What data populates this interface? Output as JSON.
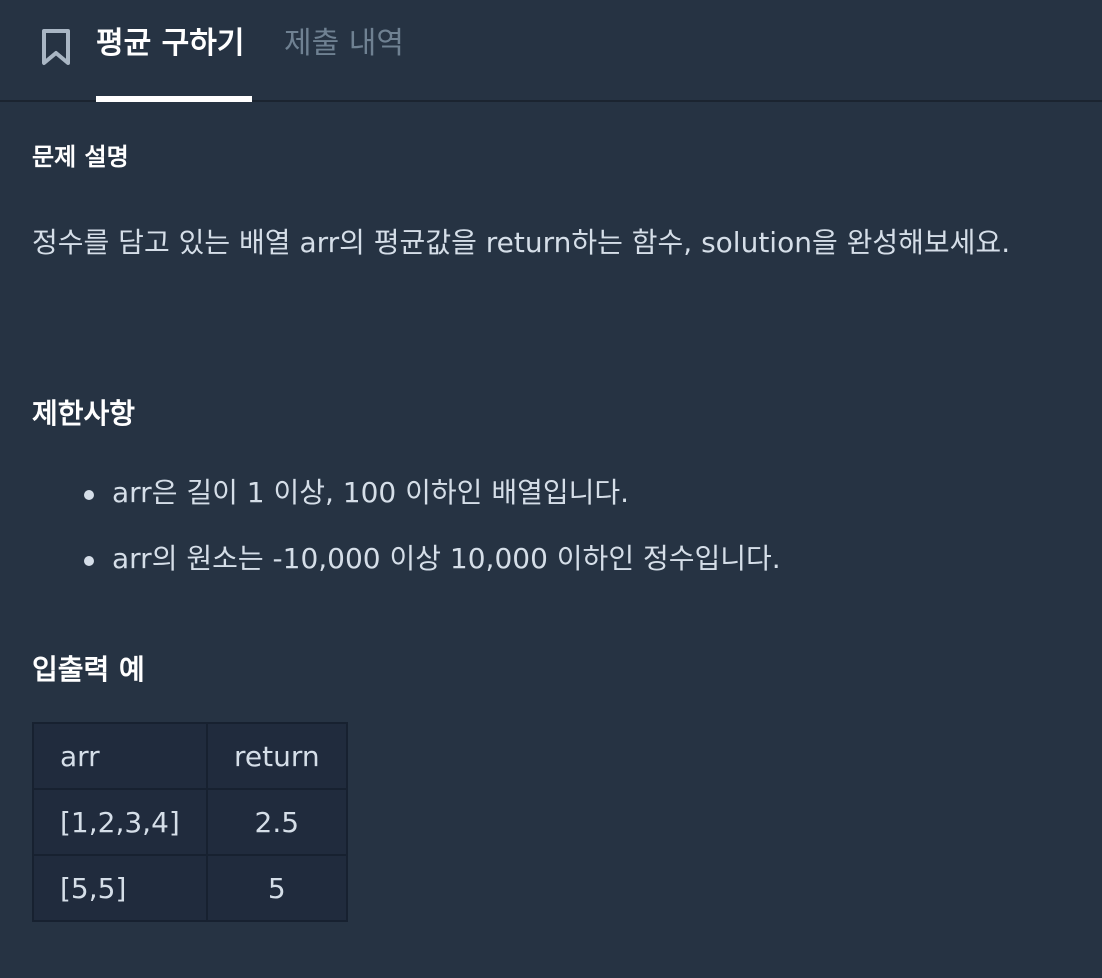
{
  "header": {
    "bookmark_icon": "bookmark-icon",
    "tabs": [
      {
        "label": "평균 구하기",
        "active": true
      },
      {
        "label": "제출 내역",
        "active": false
      }
    ]
  },
  "problem": {
    "description_title": "문제 설명",
    "description": "정수를 담고 있는 배열 arr의 평균값을 return하는 함수, solution을 완성해보세요.",
    "constraints_title": "제한사항",
    "constraints": [
      "arr은 길이 1 이상, 100 이하인 배열입니다.",
      "arr의 원소는 -10,000 이상 10,000 이하인 정수입니다."
    ],
    "examples_title": "입출력 예",
    "examples_table": {
      "headers": [
        "arr",
        "return"
      ],
      "rows": [
        [
          "[1,2,3,4]",
          "2.5"
        ],
        [
          "[5,5]",
          "5"
        ]
      ]
    }
  },
  "colors": {
    "background": "#263343",
    "text": "#d5dee8",
    "active_tab": "#ffffff",
    "inactive_tab": "#6f8192"
  }
}
